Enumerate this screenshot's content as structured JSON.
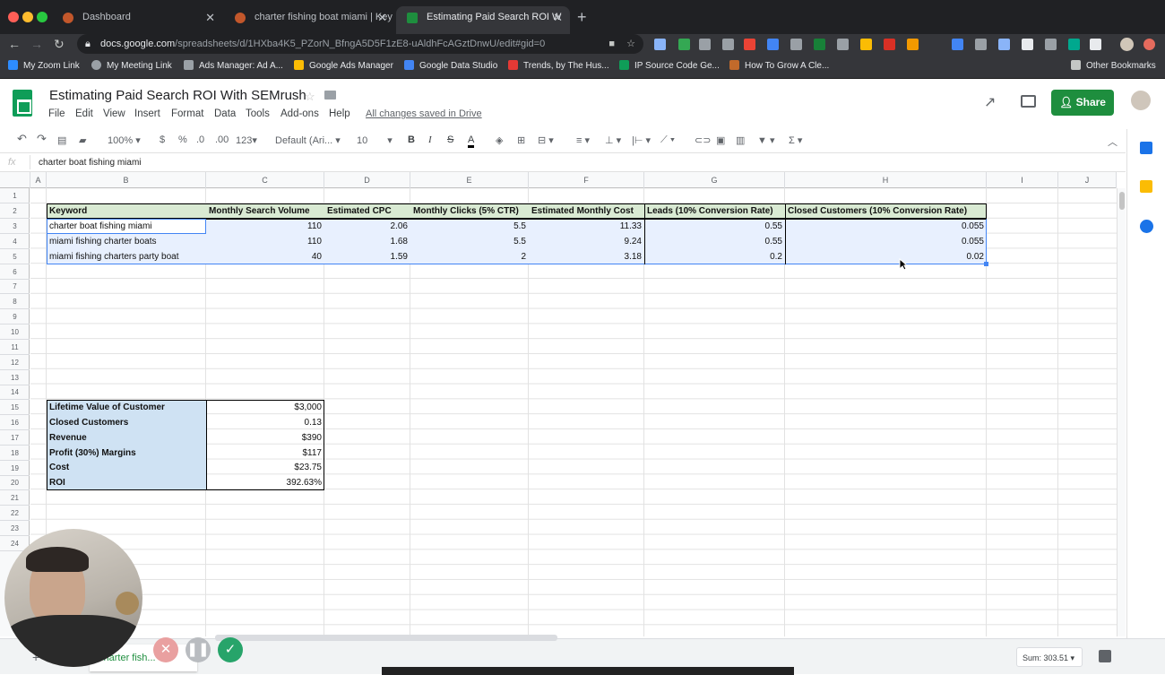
{
  "browser": {
    "tabs": [
      {
        "title": "Dashboard"
      },
      {
        "title": "charter fishing boat miami | Key"
      },
      {
        "title": "Estimating Paid Search ROI W"
      }
    ],
    "url_host": "docs.google.com",
    "url_path": "/spreadsheets/d/1HXba4K5_PZorN_BfngA5D5F1zE8-uAldhFcAGztDnwU/edit#gid=0",
    "bookmarks": [
      "My Zoom Link",
      "My Meeting Link",
      "Ads Manager: Ad A...",
      "Google Ads Manager",
      "Google Data Studio",
      "Trends, by The Hus...",
      "IP Source Code Ge...",
      "How To Grow A Cle..."
    ],
    "other_bookmarks": "Other Bookmarks"
  },
  "sheets": {
    "title": "Estimating Paid Search ROI With SEMrush",
    "menu": [
      "File",
      "Edit",
      "View",
      "Insert",
      "Format",
      "Data",
      "Tools",
      "Add-ons",
      "Help"
    ],
    "saved_status": "All changes saved in Drive",
    "share_label": "Share",
    "toolbar": {
      "zoom": "100%",
      "currency": "$",
      "percent": "%",
      "dec_less": ".0",
      "dec_more": ".00",
      "format": "123",
      "font": "Default (Ari...",
      "font_size": "10",
      "sigma": "Σ"
    },
    "fx_label": "fx",
    "formula_value": "charter boat fishing miami",
    "columns": [
      "A",
      "B",
      "C",
      "D",
      "E",
      "F",
      "G",
      "H",
      "I",
      "J"
    ],
    "rows": [
      "1",
      "2",
      "3",
      "4",
      "5",
      "6",
      "7",
      "8",
      "9",
      "10",
      "11",
      "12",
      "13",
      "14",
      "15",
      "16",
      "17",
      "18",
      "19",
      "20",
      "21",
      "22",
      "23",
      "24"
    ],
    "table_headers": [
      "Keyword",
      "Monthly Search Volume",
      "Estimated CPC",
      "Monthly Clicks (5% CTR)",
      "Estimated Monthly Cost",
      "Leads (10% Conversion Rate)",
      "Closed Customers (10% Conversion Rate)"
    ],
    "table_rows": [
      [
        "charter boat fishing miami",
        "110",
        "2.06",
        "5.5",
        "11.33",
        "0.55",
        "0.055"
      ],
      [
        "miami fishing charter boats",
        "110",
        "1.68",
        "5.5",
        "9.24",
        "0.55",
        "0.055"
      ],
      [
        "miami fishing charters party boat",
        "40",
        "1.59",
        "2",
        "3.18",
        "0.2",
        "0.02"
      ]
    ],
    "summary": [
      {
        "label": "Lifetime Value of Customer",
        "value": "$3,000"
      },
      {
        "label": "Closed Customers",
        "value": "0.13"
      },
      {
        "label": "Revenue",
        "value": "$390"
      },
      {
        "label": "Profit (30%) Margins",
        "value": "$117"
      },
      {
        "label": "Cost",
        "value": "$23.75"
      },
      {
        "label": "ROI",
        "value": "392.63%"
      }
    ],
    "sheet_tab": "charter fish...",
    "sum_label": "Sum: 303.51"
  },
  "colors": {
    "accent_green": "#1e8e3e",
    "header_fill": "#d9ead3",
    "selection_fill": "#e8f0fe",
    "label_fill": "#cfe2f3"
  }
}
